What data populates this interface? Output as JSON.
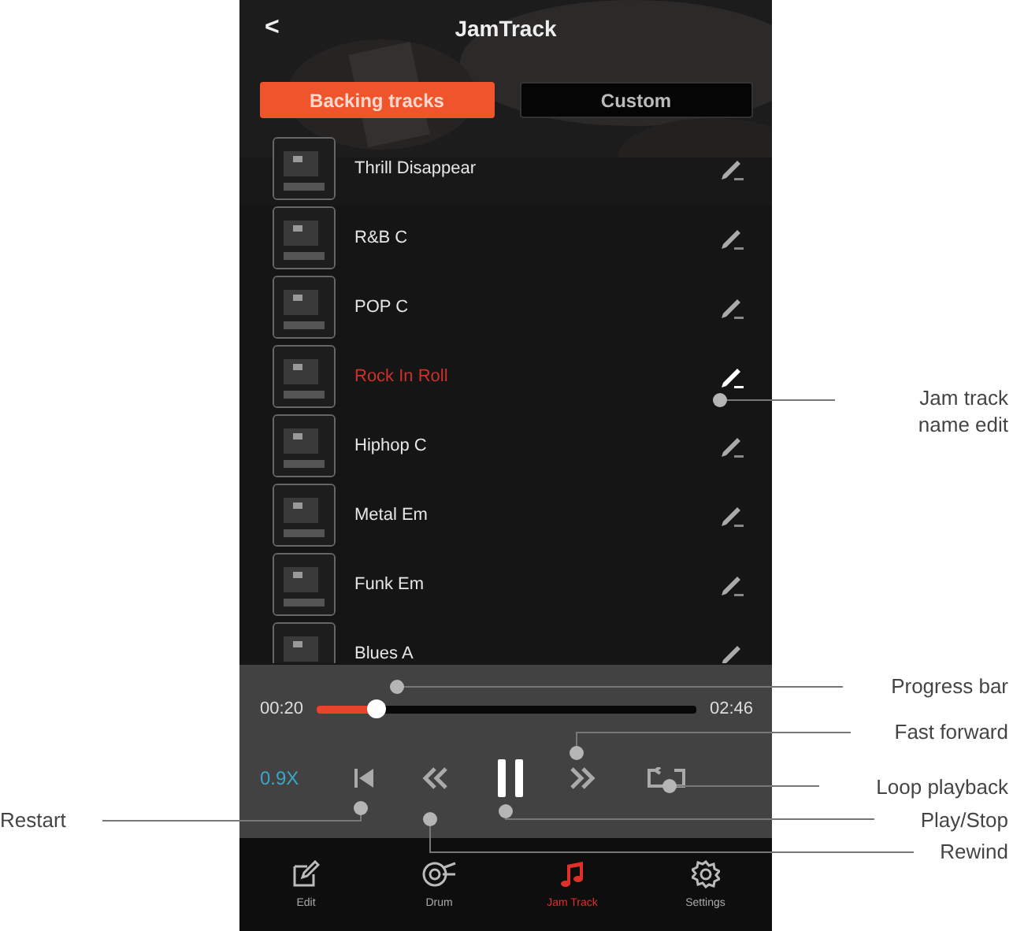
{
  "header": {
    "back": "<",
    "title": "JamTrack"
  },
  "tabs": [
    {
      "label": "Backing tracks",
      "selected": true
    },
    {
      "label": "Custom",
      "selected": false
    }
  ],
  "tracks": [
    {
      "name": "Thrill Disappear",
      "selected": false
    },
    {
      "name": "R&B C",
      "selected": false
    },
    {
      "name": "POP C",
      "selected": false
    },
    {
      "name": "Rock In Roll",
      "selected": true
    },
    {
      "name": "Hiphop C",
      "selected": false
    },
    {
      "name": "Metal Em",
      "selected": false
    },
    {
      "name": "Funk Em",
      "selected": false
    },
    {
      "name": "Blues A",
      "selected": false
    }
  ],
  "player": {
    "elapsed": "00:20",
    "total": "02:46",
    "level": 0.16,
    "speed": "0.9X",
    "playing": true
  },
  "nav": [
    {
      "label": "Edit",
      "kind": "edit",
      "selected": false
    },
    {
      "label": "Drum",
      "kind": "drum",
      "selected": false
    },
    {
      "label": "Jam Track",
      "kind": "music",
      "selected": true
    },
    {
      "label": "Settings",
      "kind": "settings",
      "selected": false
    }
  ],
  "callouts": [
    {
      "lines": [
        "Jam track",
        "name edit"
      ]
    },
    {
      "lines": [
        "Progress bar"
      ]
    },
    {
      "lines": [
        "Fast forward"
      ]
    },
    {
      "lines": [
        "Loop playback"
      ]
    },
    {
      "lines": [
        "Restart"
      ]
    },
    {
      "lines": [
        "Play/Stop"
      ]
    },
    {
      "lines": [
        "Rewind"
      ]
    }
  ]
}
